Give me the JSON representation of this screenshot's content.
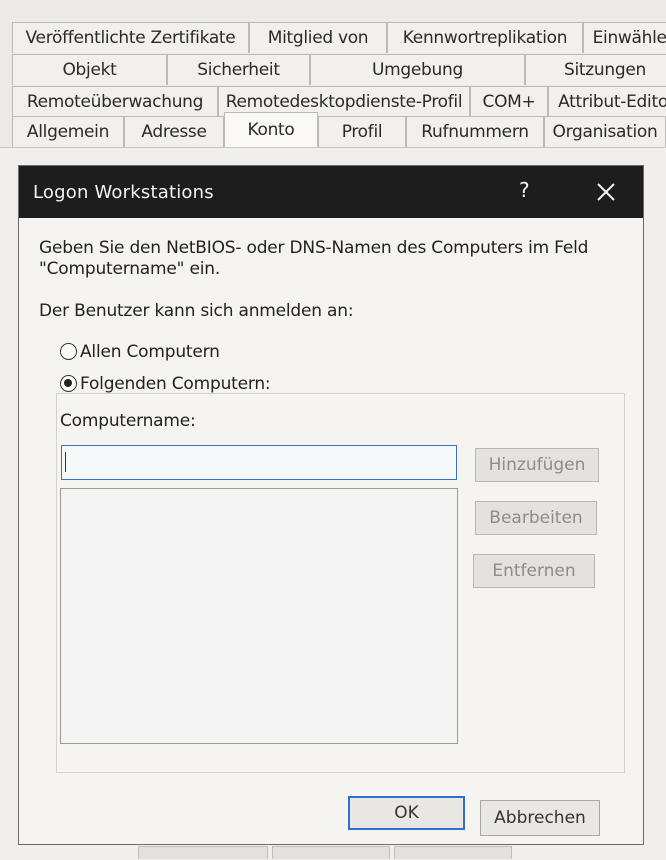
{
  "tabs": {
    "row1": [
      "Veröffentlichte Zertifikate",
      "Mitglied von",
      "Kennwortreplikation",
      "Einwähler"
    ],
    "row2": [
      "Objekt",
      "Sicherheit",
      "Umgebung",
      "Sitzungen"
    ],
    "row3": [
      "Remoteüberwachung",
      "Remotedesktopdienste-Profil",
      "COM+",
      "Attribut-Edito"
    ],
    "row4": [
      "Allgemein",
      "Adresse",
      "Konto",
      "Profil",
      "Rufnummern",
      "Organisation"
    ],
    "active": "Konto"
  },
  "dialog": {
    "title": "Logon Workstations",
    "help_label": "?",
    "instruction_line1": "Geben Sie den NetBIOS- oder DNS-Namen des Computers im Feld",
    "instruction_line2": "\"Computername\" ein.",
    "logon_label": "Der Benutzer kann sich anmelden an:",
    "radio_all": "Allen Computern",
    "radio_following": "Folgenden Computern:",
    "selected_option": "Folgenden Computern:",
    "computername_label": "Computername:",
    "computername_value": "",
    "buttons": {
      "add": "Hinzufügen",
      "edit": "Bearbeiten",
      "remove": "Entfernen",
      "ok": "OK",
      "cancel": "Abbrechen"
    }
  },
  "colors": {
    "titlebar": "#1d1d1d",
    "focus_border": "#3b70c8",
    "default_button_border": "#2f6fd0"
  }
}
